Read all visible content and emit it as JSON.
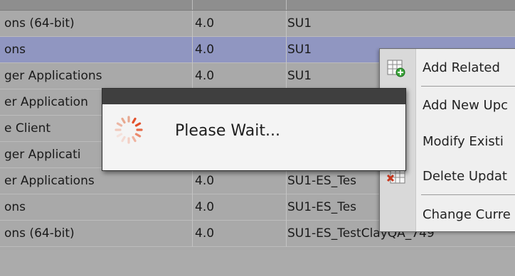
{
  "table": {
    "rows": [
      {
        "name": "ons (64-bit)",
        "version": "4.0",
        "service_pack": "SU1",
        "selected": false
      },
      {
        "name": "ons",
        "version": "4.0",
        "service_pack": "SU1",
        "selected": true
      },
      {
        "name": "ger Applications",
        "version": "4.0",
        "service_pack": "SU1",
        "selected": false
      },
      {
        "name": "er Application",
        "version": "",
        "service_pack": "",
        "selected": false
      },
      {
        "name": "e Client",
        "version": "",
        "service_pack": "",
        "selected": false
      },
      {
        "name": "ger Applicati",
        "version": "",
        "service_pack": "",
        "selected": false
      },
      {
        "name": "er Applications",
        "version": "4.0",
        "service_pack": "SU1-ES_Tes",
        "selected": false
      },
      {
        "name": "ons",
        "version": "4.0",
        "service_pack": "SU1-ES_Tes",
        "selected": false
      },
      {
        "name": "ons (64-bit)",
        "version": "4.0",
        "service_pack": "SU1-ES_TestClayQA_749",
        "selected": false
      }
    ]
  },
  "context_menu": {
    "items": [
      {
        "label": "Add Related",
        "icon": "add-related-grid-icon"
      },
      {
        "label": "Add New Upc",
        "icon": ""
      },
      {
        "label": "Modify Existi",
        "icon": ""
      },
      {
        "label": "Delete Updat",
        "icon": "delete-grid-icon"
      },
      {
        "label": "Change Curre",
        "icon": ""
      }
    ]
  },
  "dialog": {
    "message": "Please Wait...",
    "spinner_icon": "loading-spinner-icon",
    "accent_color": "#e2502a"
  }
}
